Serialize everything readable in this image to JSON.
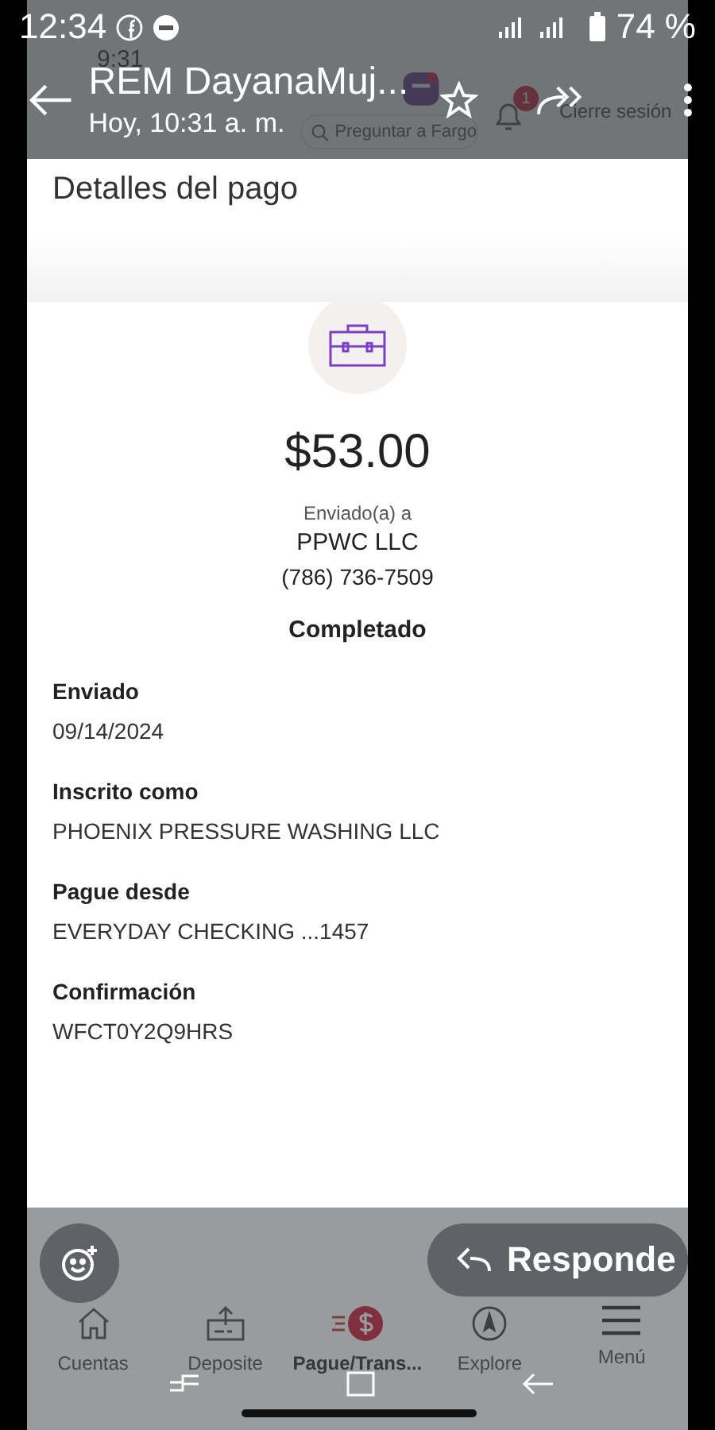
{
  "status_bar": {
    "time": "12:34",
    "battery": "74 %"
  },
  "viewer_header": {
    "title": "REM DayanaMuj...",
    "subtitle": "Hoy, 10:31 a. m."
  },
  "underlying_header": {
    "time": "9:31",
    "search_placeholder": "Preguntar a Fargo",
    "notification_count": "1",
    "sign_out": "Cierre sesión"
  },
  "page": {
    "title": "Detalles del pago",
    "amount": "$53.00",
    "sent_to_label": "Enviado(a) a",
    "recipient": "PPWC LLC",
    "phone": "(786) 736-7509",
    "status": "Completado",
    "details": [
      {
        "label": "Enviado",
        "value": "09/14/2024"
      },
      {
        "label": "Inscrito como",
        "value": "PHOENIX PRESSURE WASHING LLC"
      },
      {
        "label": "Pague desde",
        "value": "EVERYDAY CHECKING ...1457"
      },
      {
        "label": "Confirmación",
        "value": "WFCT0Y2Q9HRS"
      }
    ]
  },
  "bottom_nav": [
    {
      "kind": "home",
      "label": "Cuentas",
      "selected": false
    },
    {
      "kind": "deposit",
      "label": "Deposite",
      "selected": false
    },
    {
      "kind": "pay",
      "label": "Pague/Trans...",
      "selected": true
    },
    {
      "kind": "explore",
      "label": "Explore",
      "selected": false
    },
    {
      "kind": "menu",
      "label": "Menú",
      "selected": false
    }
  ],
  "reply_button": {
    "label": "Responde"
  }
}
